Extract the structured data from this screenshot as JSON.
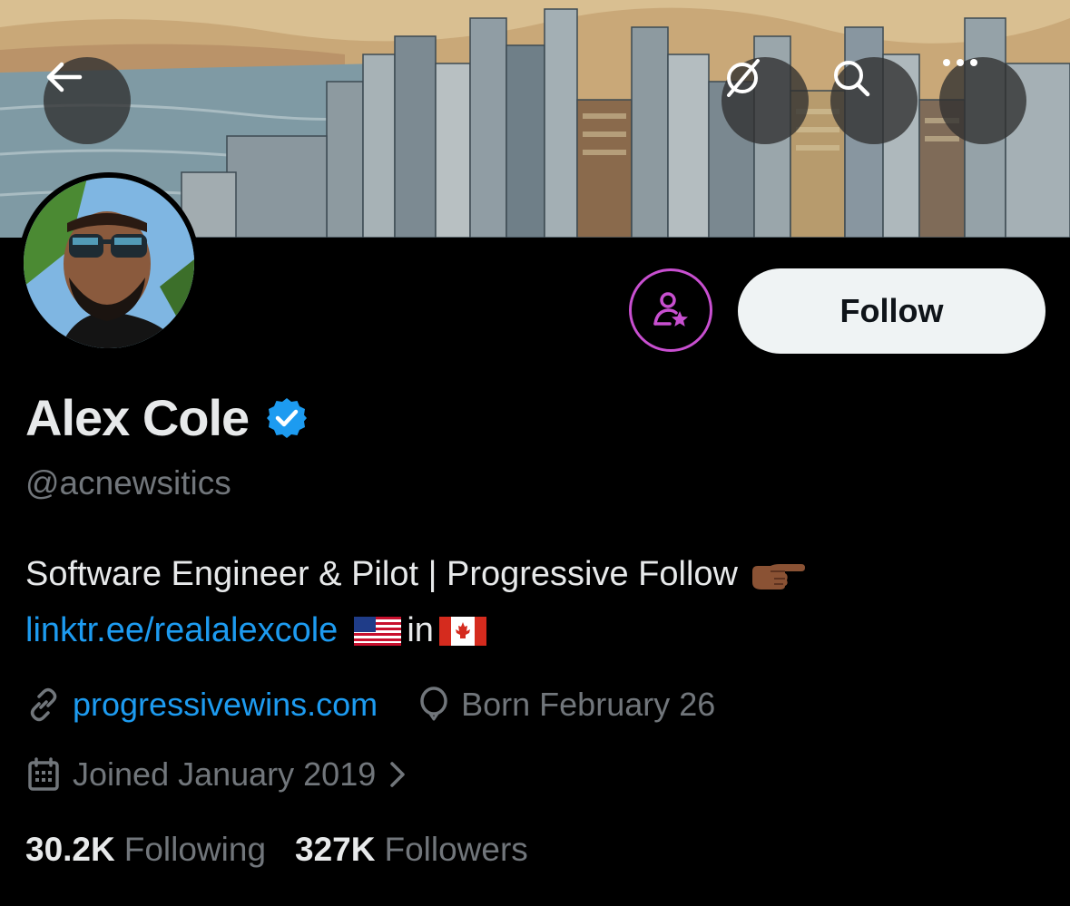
{
  "profile": {
    "display_name": "Alex Cole",
    "handle": "@acnewsitics",
    "bio_line1": "Software Engineer & Pilot | Progressive Follow",
    "bio_link": "linktr.ee/realalexcole",
    "bio_in": "in",
    "website": "progressivewins.com",
    "birthday": "Born February 26",
    "joined": "Joined January 2019",
    "following_count": "30.2K",
    "following_label": "Following",
    "followers_count": "327K",
    "followers_label": "Followers"
  },
  "actions": {
    "follow_label": "Follow"
  },
  "icons": {
    "back": "arrow-left-icon",
    "grok": "grok-icon",
    "search": "search-icon",
    "more": "more-icon",
    "creator": "creator-subscribe-icon",
    "verified": "verified-badge-icon",
    "link": "link-icon",
    "balloon": "balloon-icon",
    "calendar": "calendar-icon",
    "chevron": "chevron-right-icon",
    "pointing": "pointing-right-emoji",
    "us_flag": "us-flag-emoji",
    "ca_flag": "canada-flag-emoji"
  },
  "colors": {
    "accent": "#1d9bf0",
    "creator": "#c84fd0",
    "muted": "#71767b",
    "text": "#e7e9ea"
  }
}
